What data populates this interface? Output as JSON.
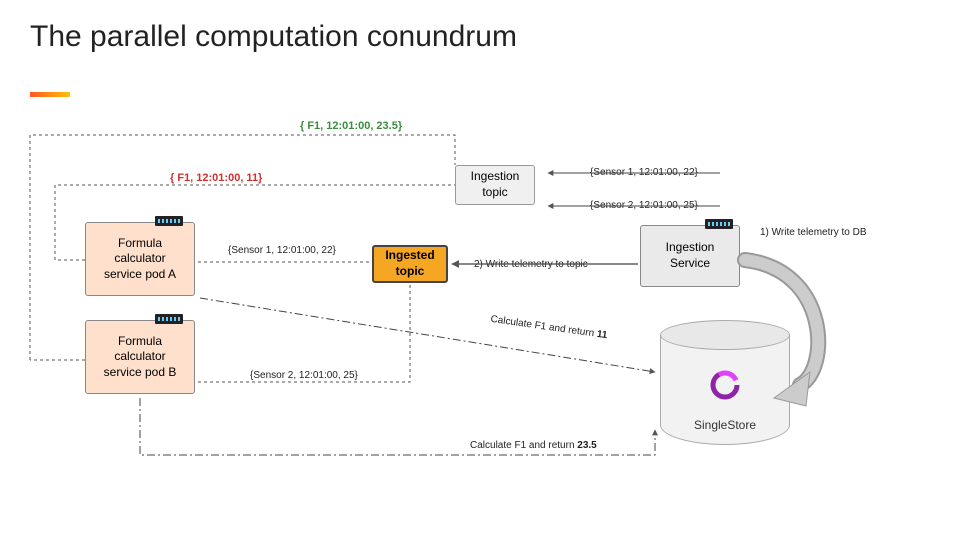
{
  "title": "The parallel computation conundrum",
  "nodes": {
    "pod_a": "Formula calculator service pod A",
    "pod_b": "Formula calculator service pod B",
    "ingestion_topic": "Ingestion topic",
    "ingested_topic": "Ingested topic",
    "ingestion_service": "Ingestion Service",
    "database": "SingleStore"
  },
  "messages": {
    "green_result": "{ F1, 12:01:00, 23.5}",
    "red_result": "{ F1, 12:01:00, 11}",
    "sensor1": "{Sensor 1, 12:01:00, 22}",
    "sensor2": "{Sensor 2, 12:01:00, 25}",
    "sensor1_b": "{Sensor 1, 12:01:00, 22}",
    "sensor2_b": "{Sensor 2, 12:01:00, 25}"
  },
  "steps": {
    "step1": "1) Write telemetry to DB",
    "step2": "2) Write telemetry to topic",
    "calc_a": "Calculate F1 and return 11",
    "calc_b": "Calculate F1 and return 23.5"
  }
}
